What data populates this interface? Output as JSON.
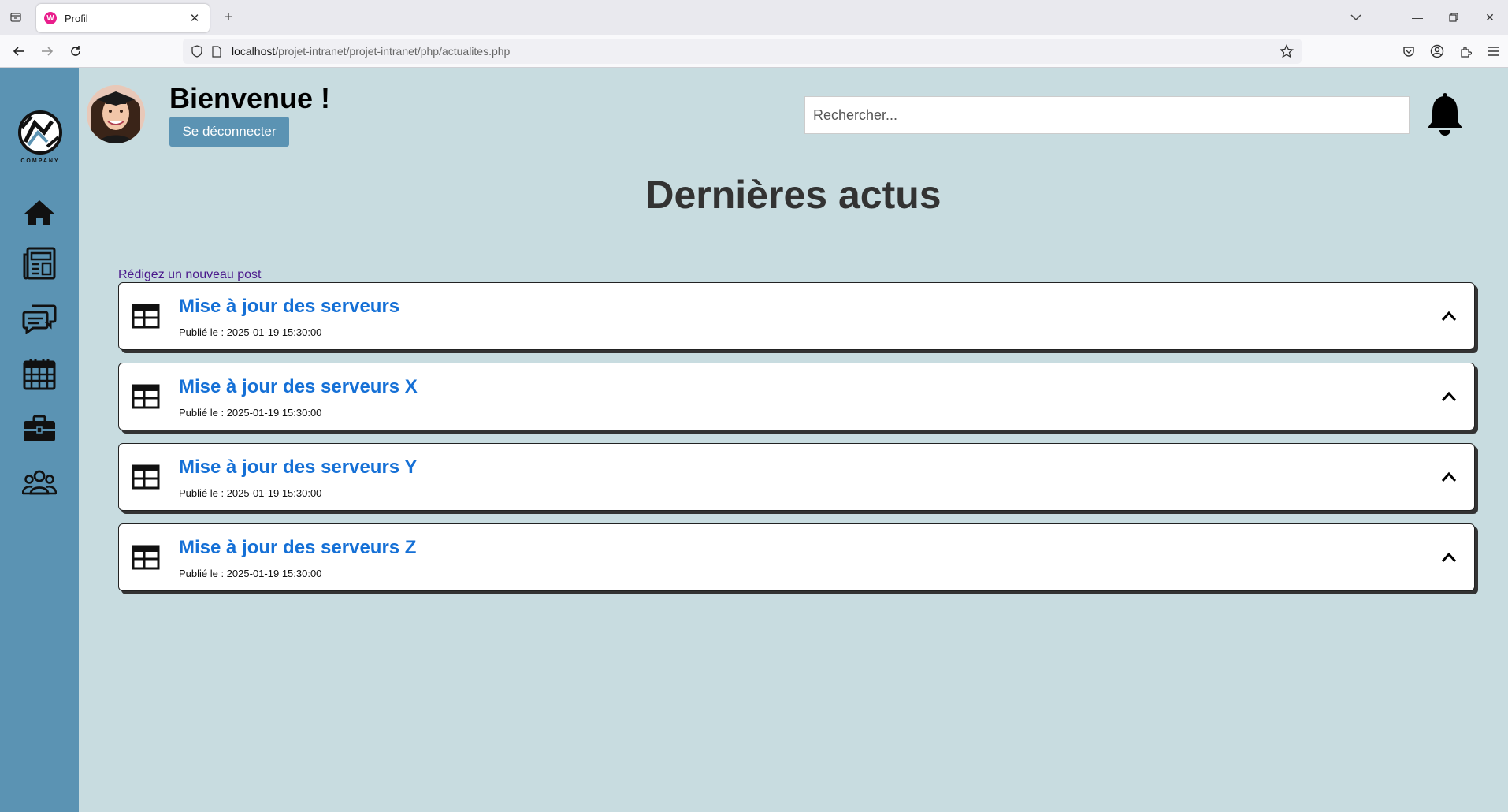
{
  "browser": {
    "tab_title": "Profil",
    "favicon_letter": "W",
    "url_host": "localhost",
    "url_path": "/projet-intranet/projet-intranet/php/actualites.php"
  },
  "header": {
    "welcome": "Bienvenue !",
    "logout_label": "Se déconnecter",
    "search_placeholder": "Rechercher..."
  },
  "sidebar": {
    "logo_text": "COMPANY",
    "items": [
      {
        "icon": "home-icon"
      },
      {
        "icon": "newspaper-icon"
      },
      {
        "icon": "chat-icon"
      },
      {
        "icon": "calendar-icon"
      },
      {
        "icon": "briefcase-icon"
      },
      {
        "icon": "users-icon"
      }
    ]
  },
  "main": {
    "title": "Dernières actus",
    "new_post_link": "Rédigez un nouveau post",
    "news": [
      {
        "title": "Mise à jour des serveurs",
        "date": "Publié le : 2025-01-19 15:30:00"
      },
      {
        "title": "Mise à jour des serveurs X",
        "date": "Publié le : 2025-01-19 15:30:00"
      },
      {
        "title": "Mise à jour des serveurs Y",
        "date": "Publié le : 2025-01-19 15:30:00"
      },
      {
        "title": "Mise à jour des serveurs Z",
        "date": "Publié le : 2025-01-19 15:30:00"
      }
    ]
  },
  "colors": {
    "sidebar": "#5b93b3",
    "background": "#c8dce0",
    "news_title": "#1570d6",
    "link": "#4b1a8c"
  }
}
